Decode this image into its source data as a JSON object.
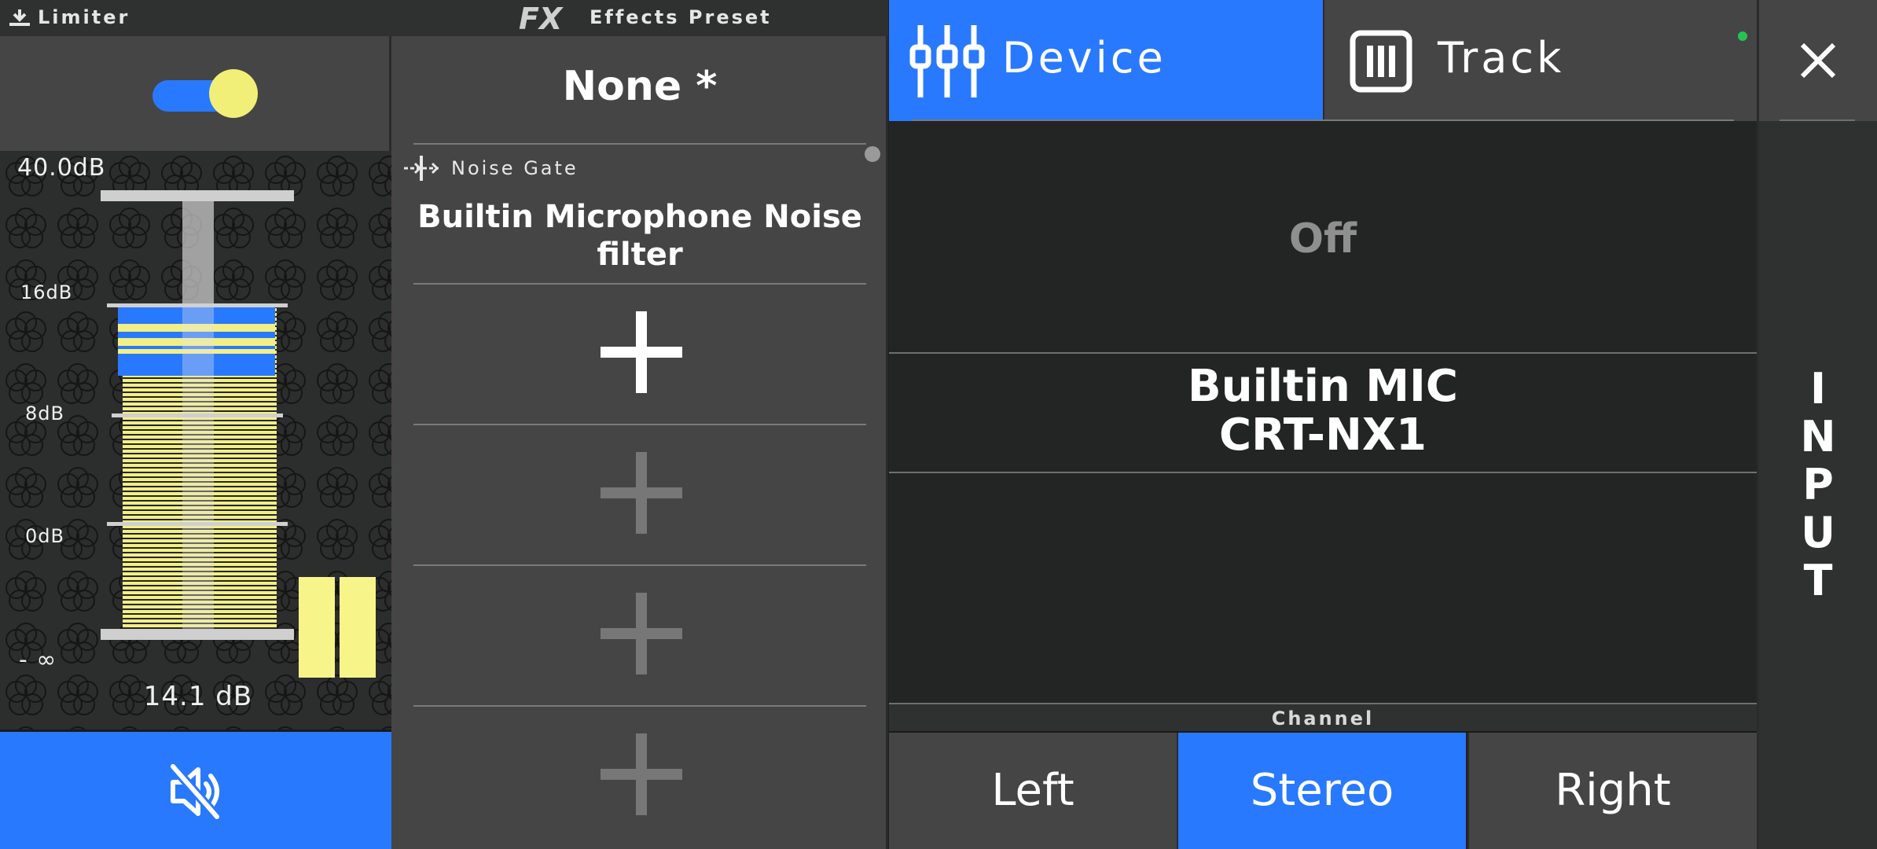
{
  "limiter": {
    "title": "Limiter",
    "enabled": true,
    "max_level": "40.0dB",
    "scale": [
      "16dB",
      "8dB",
      "0dB",
      "- ∞"
    ],
    "level_readout": "14.1 dB",
    "mute_icon": "speaker-muted-icon"
  },
  "effects": {
    "title": "Effects Preset",
    "logo": "FX",
    "preset_name": "None *",
    "slots": [
      {
        "type": "Noise Gate",
        "name": "Builtin Microphone Noise filter"
      },
      {
        "type": "add",
        "active": true
      },
      {
        "type": "add",
        "active": false
      },
      {
        "type": "add",
        "active": false
      },
      {
        "type": "add",
        "active": false
      }
    ]
  },
  "tabs": {
    "device": {
      "label": "Device",
      "selected": true
    },
    "track": {
      "label": "Track",
      "selected": false
    }
  },
  "device": {
    "status": "Off",
    "mic_line1": "Builtin MIC",
    "mic_line2": "CRT-NX1"
  },
  "channel": {
    "label": "Channel",
    "options": [
      "Left",
      "Stereo",
      "Right"
    ],
    "selected": "Stereo"
  },
  "side_panel": {
    "title": "INPUT"
  },
  "colors": {
    "accent": "#2979ff",
    "meter": "#f2ef85",
    "status_ok": "#23c552"
  }
}
